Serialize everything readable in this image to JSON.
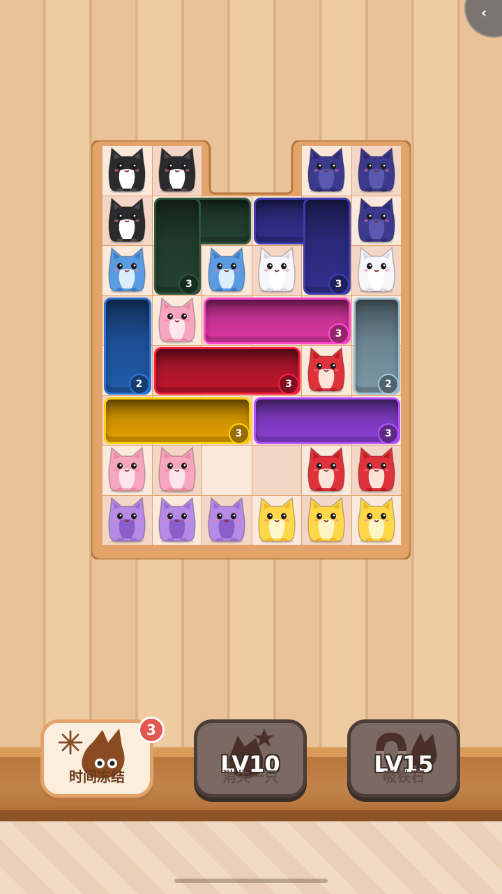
{
  "top_right_button": {
    "icon": "chevron-left-icon",
    "glyph": "‹"
  },
  "board": {
    "cats": [
      {
        "color": "black",
        "row": 0,
        "col": 0
      },
      {
        "color": "black",
        "row": 0,
        "col": 1
      },
      {
        "color": "navy",
        "row": 0,
        "col": 4
      },
      {
        "color": "navy",
        "row": 0,
        "col": 5
      },
      {
        "color": "black",
        "row": 1,
        "col": 0
      },
      {
        "color": "navy",
        "row": 1,
        "col": 5
      },
      {
        "color": "blue",
        "row": 2,
        "col": 0
      },
      {
        "color": "blue",
        "row": 2,
        "col": 2
      },
      {
        "color": "white",
        "row": 2,
        "col": 3
      },
      {
        "color": "white",
        "row": 2,
        "col": 5
      },
      {
        "color": "pink",
        "row": 3,
        "col": 1
      },
      {
        "color": "red",
        "row": 4,
        "col": 4
      },
      {
        "color": "pink",
        "row": 6,
        "col": 0
      },
      {
        "color": "pink",
        "row": 6,
        "col": 1
      },
      {
        "color": "red",
        "row": 6,
        "col": 4
      },
      {
        "color": "red",
        "row": 6,
        "col": 5
      },
      {
        "color": "purple",
        "row": 7,
        "col": 0
      },
      {
        "color": "purple",
        "row": 7,
        "col": 1
      },
      {
        "color": "purple",
        "row": 7,
        "col": 2
      },
      {
        "color": "yellow",
        "row": 7,
        "col": 3
      },
      {
        "color": "yellow",
        "row": 7,
        "col": 4
      },
      {
        "color": "yellow",
        "row": 7,
        "col": 5
      }
    ],
    "blocks": [
      {
        "name": "dark-green-block",
        "color": "#1f3a2a",
        "count": "3"
      },
      {
        "name": "navy-block",
        "color": "#2a2a7a",
        "count": "3"
      },
      {
        "name": "blue-block",
        "color": "#1d4f94",
        "count": "2"
      },
      {
        "name": "magenta-block",
        "color": "#c2318f",
        "count": "3"
      },
      {
        "name": "slate-block",
        "color": "#6b8490",
        "count": "2"
      },
      {
        "name": "crimson-block",
        "color": "#a8142a",
        "count": "3"
      },
      {
        "name": "gold-block",
        "color": "#c98e00",
        "count": "3"
      },
      {
        "name": "violet-block",
        "color": "#7a38b8",
        "count": "3"
      }
    ]
  },
  "tools": [
    {
      "name": "time-freeze",
      "label": "时间冻结",
      "count": "3",
      "state": "active"
    },
    {
      "name": "eliminate-one",
      "label": "消失一只",
      "level": "LV10",
      "state": "locked"
    },
    {
      "name": "magnet",
      "label": "吸铁石",
      "level": "LV15",
      "state": "locked"
    }
  ],
  "colors": {
    "board_frame": "#e3a46b",
    "cell_light": "#fbe9dc",
    "cell_dark": "#f3d6c5"
  }
}
